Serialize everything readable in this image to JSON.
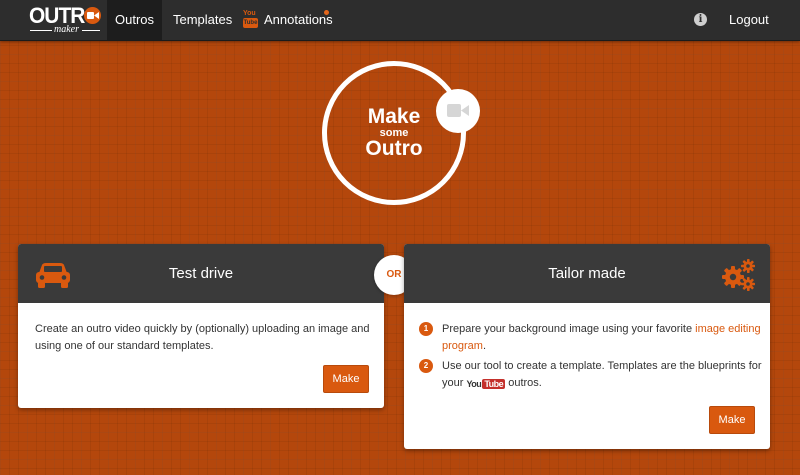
{
  "brand": {
    "logo_word": "OUTR",
    "logo_sub": "maker",
    "accent_color": "#d9590f",
    "dark_color": "#2d2d2d"
  },
  "nav": {
    "items": [
      {
        "label": "Outros",
        "active": true
      },
      {
        "label": "Templates",
        "active": false
      },
      {
        "label": "Annotations",
        "active": false
      }
    ],
    "annotations_icon_you": "You",
    "annotations_icon_tube": "Tube",
    "info_icon": "i",
    "logout_label": "Logout"
  },
  "hero": {
    "line1": "Make",
    "line2": "some",
    "line3": "Outro"
  },
  "or_label": "OR",
  "test_drive": {
    "title": "Test drive",
    "icon": "car-icon",
    "description": "Create an outro video quickly by (optionally) uploading an image and using one of our standard templates.",
    "button_label": "Make"
  },
  "tailor_made": {
    "title": "Tailor made",
    "icon": "gears-icon",
    "steps": [
      {
        "number": "1",
        "text_before": "Prepare your background image using your favorite ",
        "link": "image editing program",
        "text_after": "."
      },
      {
        "number": "2",
        "text_before": "Use our tool to create a template. Templates are the blueprints for your ",
        "yt_you": "You",
        "yt_tube": "Tube",
        "text_after": " outros."
      }
    ],
    "button_label": "Make"
  }
}
